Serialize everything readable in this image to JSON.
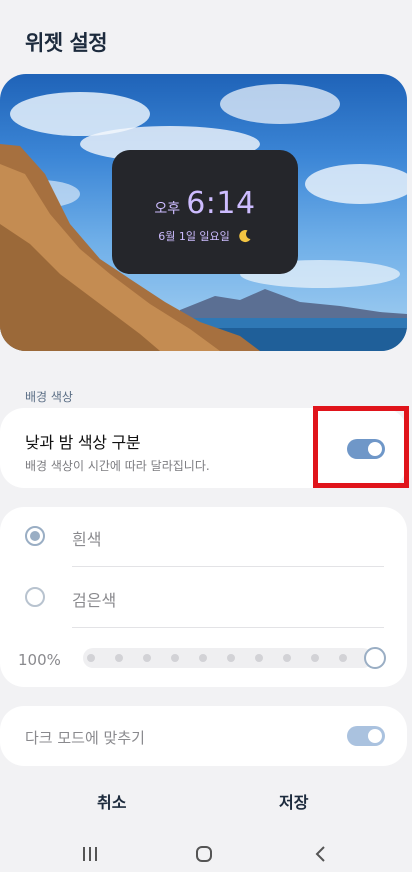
{
  "header": {
    "title": "위젯 설정"
  },
  "preview": {
    "ampm": "오후",
    "time": "6:14",
    "date": "6월 1일 일요일",
    "weather_icon": "moon-icon"
  },
  "background_color": {
    "section_label": "배경 색상",
    "day_night": {
      "title": "낮과 밤 색상 구분",
      "description": "배경 색상이 시간에 따라 달라집니다.",
      "enabled": true
    },
    "options": [
      {
        "label": "흰색",
        "selected": true
      },
      {
        "label": "검은색",
        "selected": false
      }
    ],
    "opacity_label": "100%",
    "opacity": 1.0
  },
  "dark_mode": {
    "label": "다크 모드에 맞추기",
    "enabled": true
  },
  "buttons": {
    "cancel": "취소",
    "save": "저장"
  },
  "nav": {
    "icons": [
      "recent-apps-icon",
      "home-icon",
      "back-icon"
    ]
  },
  "colors": {
    "accent": "#6f97c8",
    "highlight": "#e0141b",
    "widget_bg": "#25262b",
    "widget_text": "#cdbcff"
  }
}
